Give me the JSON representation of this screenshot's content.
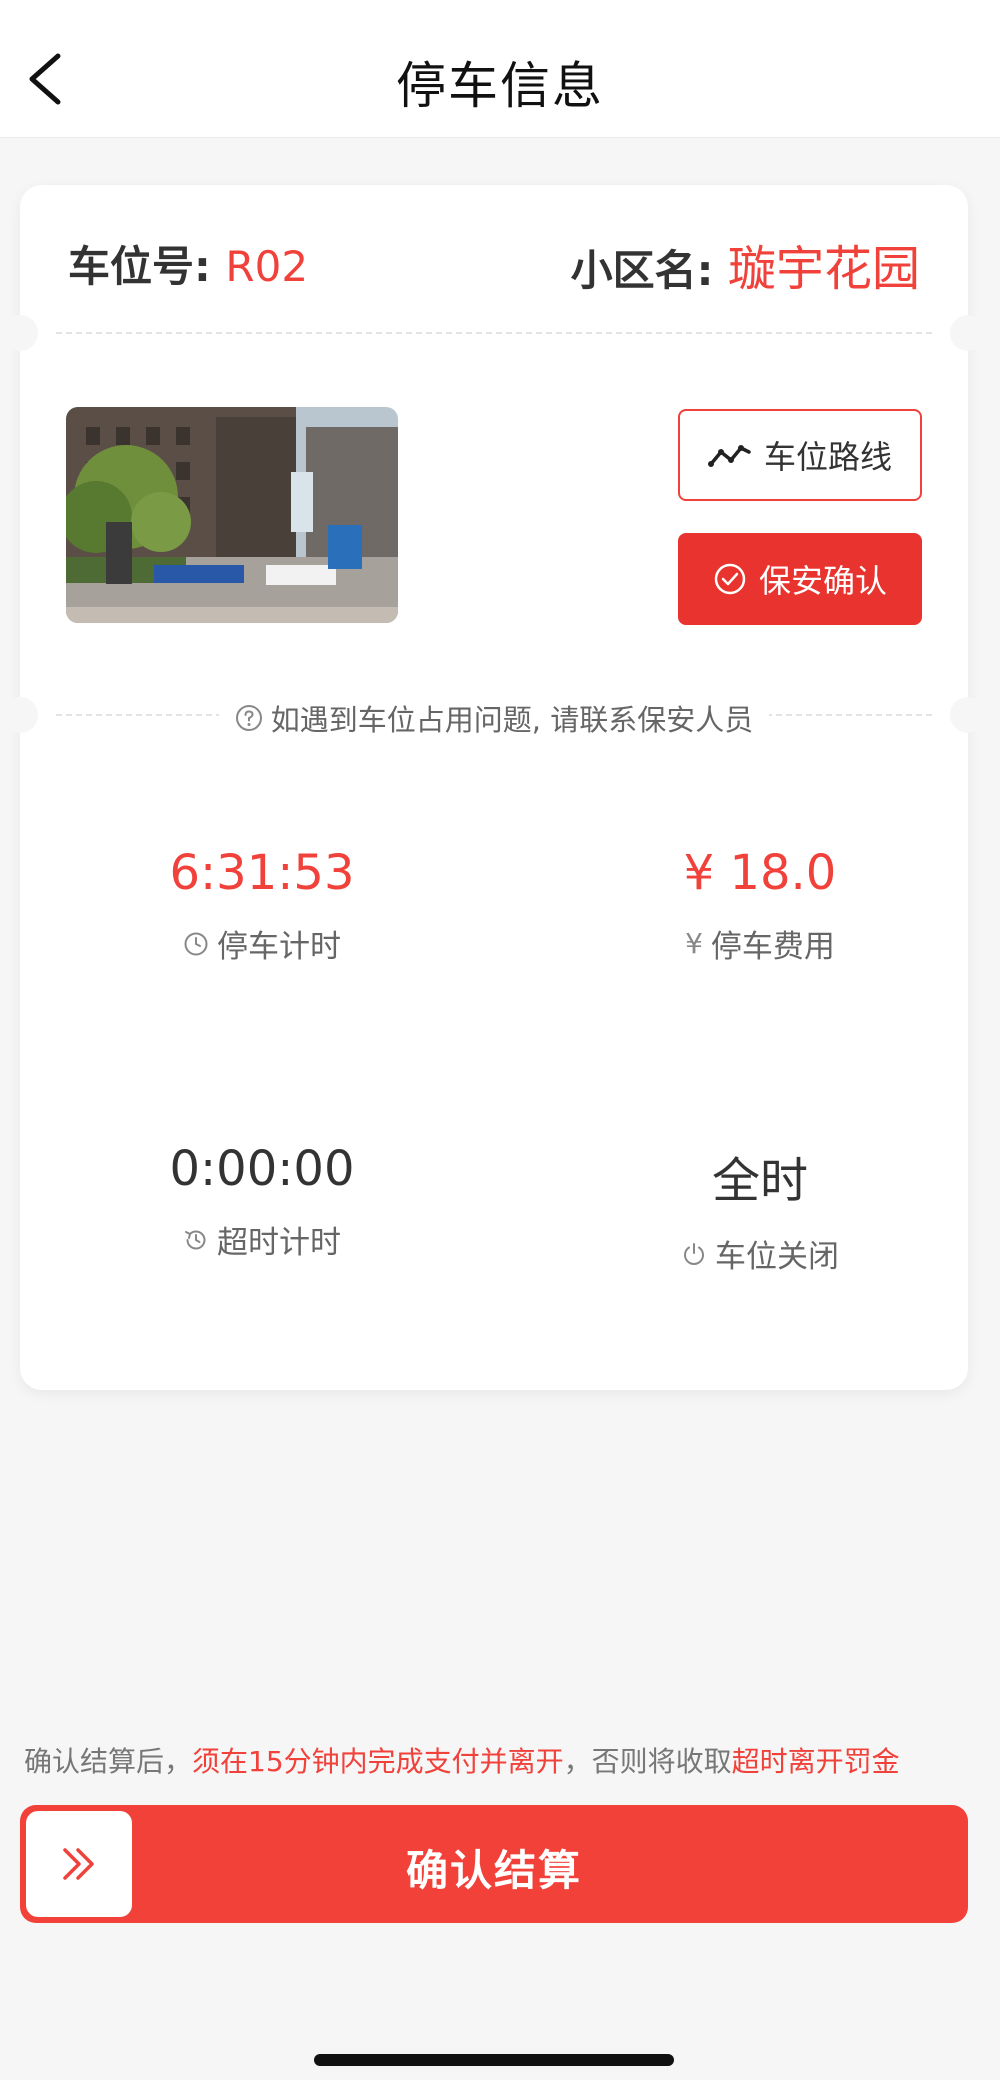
{
  "header": {
    "title": "停车信息"
  },
  "spot": {
    "label": "车位号:",
    "value": "R02"
  },
  "community": {
    "label": "小区名:",
    "value": "璇宇花园"
  },
  "actions": {
    "route_label": "车位路线",
    "guard_label": "保安确认"
  },
  "tip": "如遇到车位占用问题, 请联系保安人员",
  "stats": {
    "parking_time": {
      "value": "6:31:53",
      "label": "停车计时"
    },
    "fee": {
      "value": "¥ 18.0",
      "label": "停车费用",
      "icon": "¥"
    },
    "overtime": {
      "value": "0:00:00",
      "label": "超时计时"
    },
    "hours": {
      "value": "全时",
      "label": "车位关闭"
    }
  },
  "notice": {
    "part1": "确认结算后，",
    "part2": "须在15分钟内完成支付并离开",
    "part3": "，否则将收取",
    "part4": "超时离开罚金"
  },
  "pay": {
    "label": "确认结算"
  },
  "colors": {
    "accent": "#f0413a",
    "button": "#f24139",
    "background": "#f6f6f7"
  },
  "icons": {
    "back": "chevron-left-icon",
    "route": "route-icon",
    "guard": "check-circle-icon",
    "tip": "question-circle-icon",
    "timer": "clock-icon",
    "fee": "yen-icon",
    "overtime": "history-clock-icon",
    "closed": "power-icon",
    "pay": "double-chevron-right-icon"
  }
}
